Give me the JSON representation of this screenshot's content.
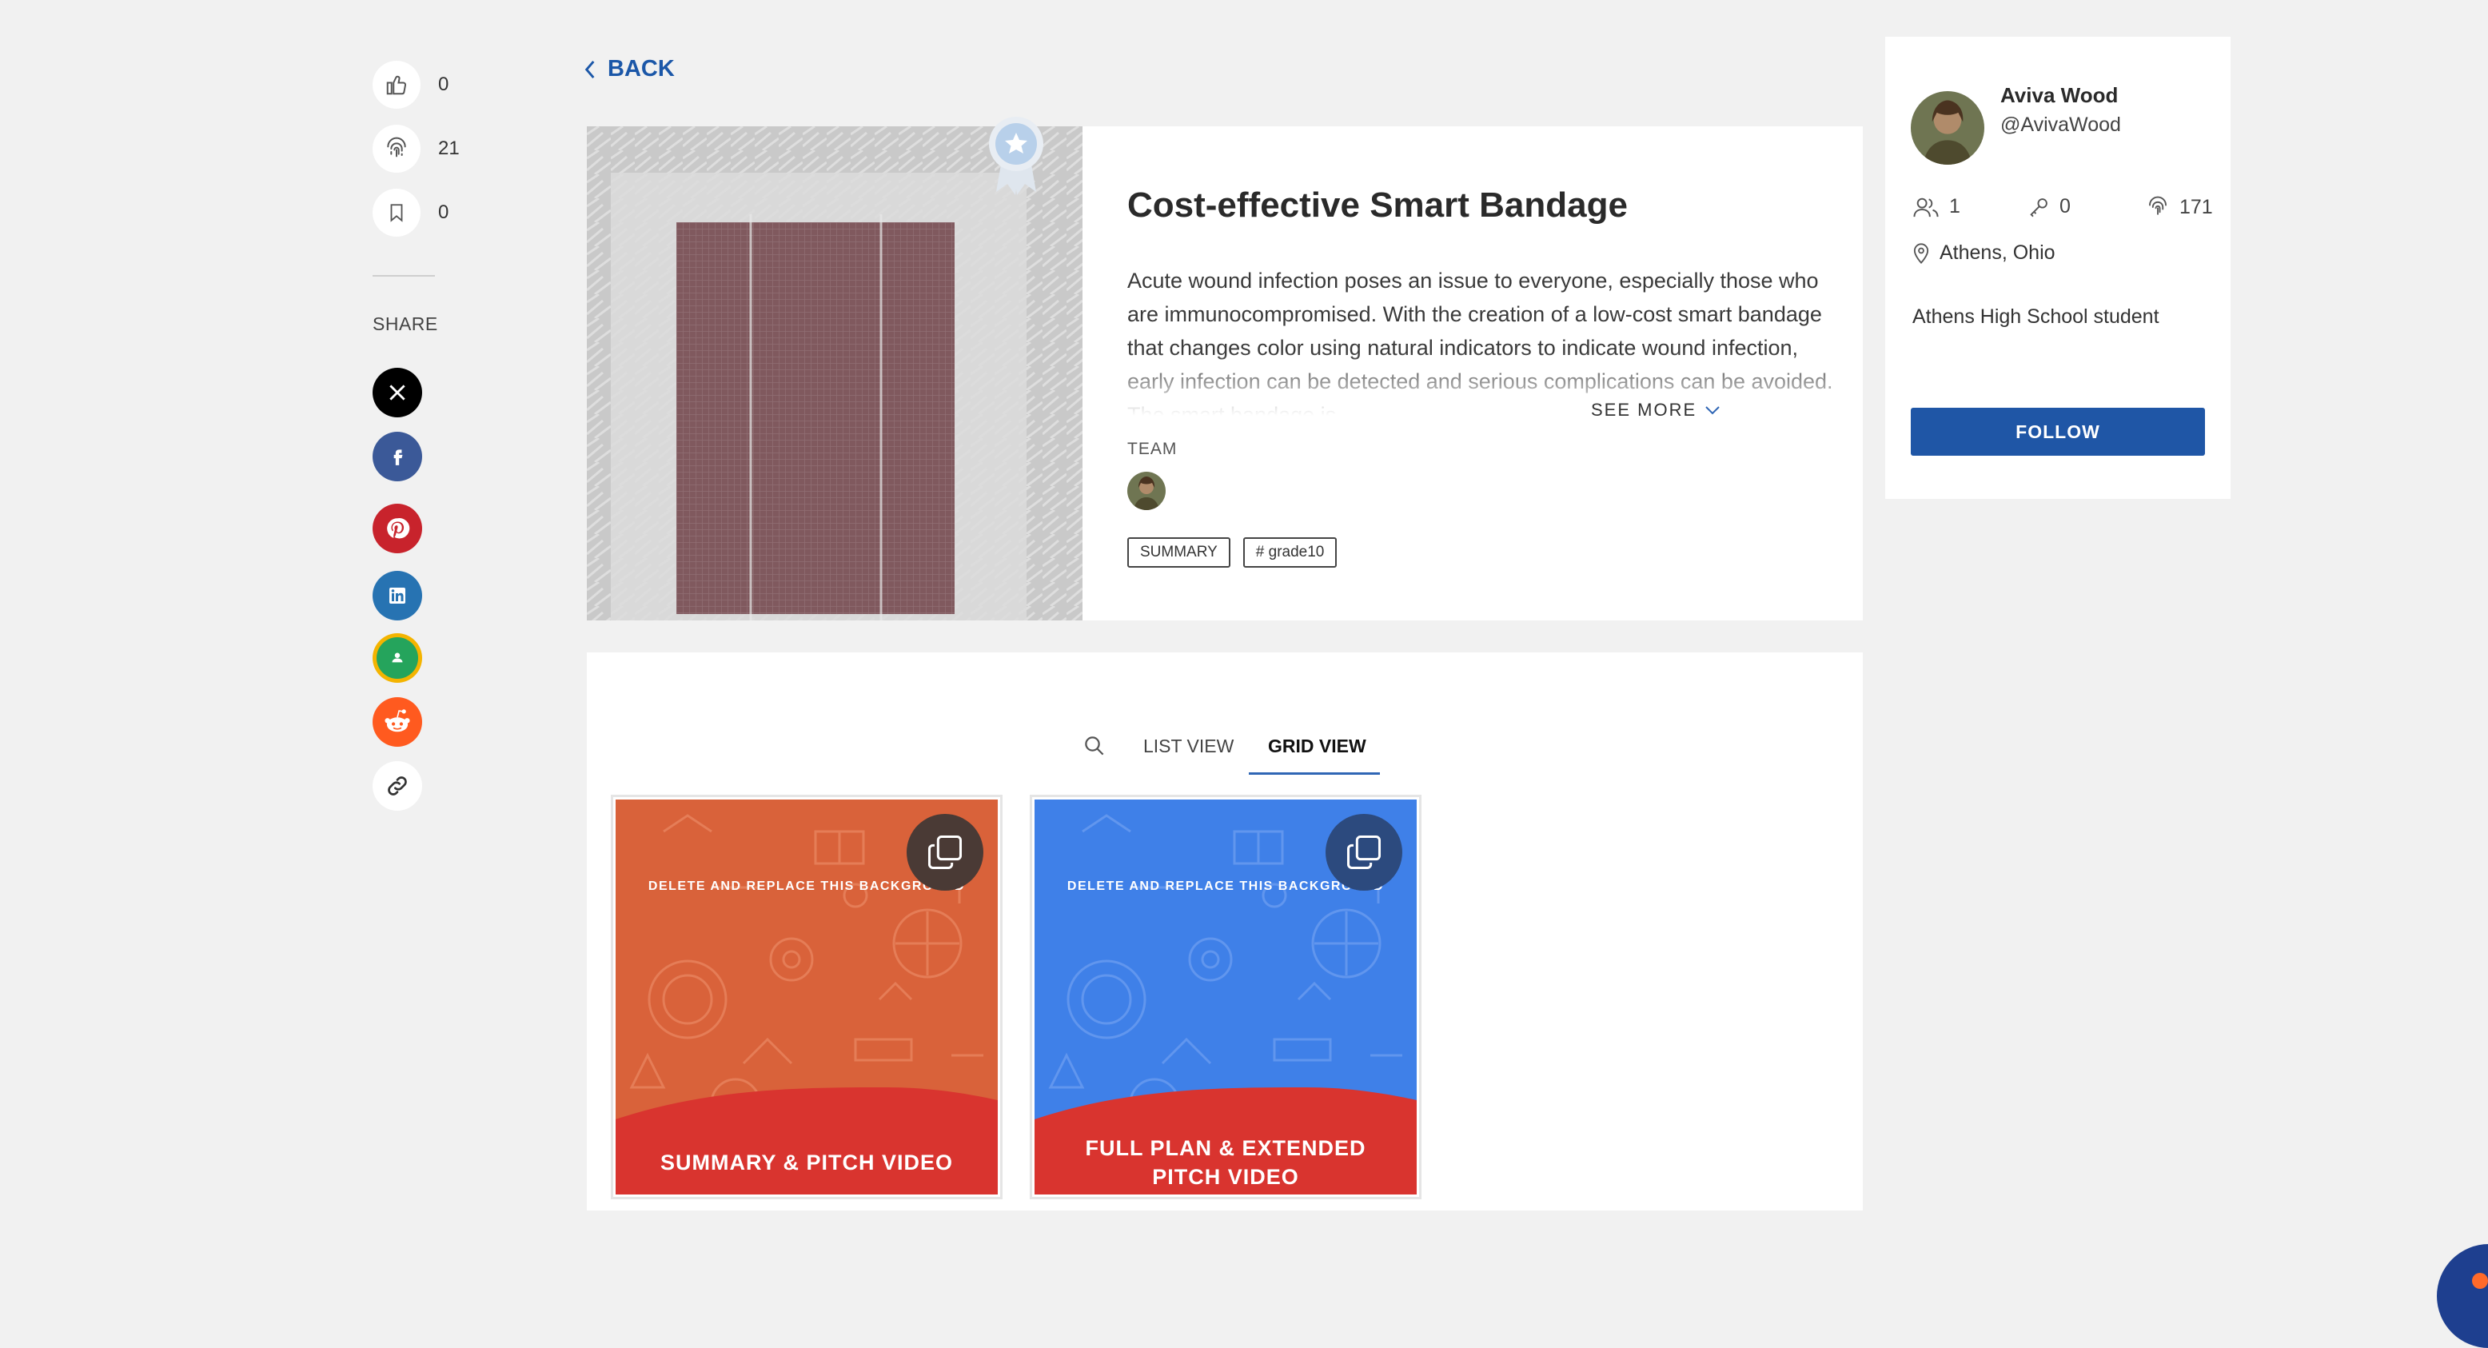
{
  "rail": {
    "likes": "0",
    "fingerprints": "21",
    "bookmarks": "0",
    "share_label": "SHARE",
    "social_icons": [
      "x-icon",
      "facebook-icon",
      "pinterest-icon",
      "linkedin-icon",
      "google-classroom-icon",
      "reddit-icon",
      "link-icon"
    ]
  },
  "nav": {
    "back_label": "BACK"
  },
  "project": {
    "title": "Cost-effective Smart Bandage",
    "description": "Acute wound infection poses an issue to everyone, especially those who are immunocompromised. With the creation of a low-cost smart bandage that changes color using natural indicators to indicate wound infection, early infection can be detected and serious complications can be avoided. The smart bandage is",
    "see_more": "SEE MORE",
    "team_label": "TEAM",
    "tags": [
      "SUMMARY",
      "# grade10"
    ]
  },
  "grid": {
    "tabs": {
      "list": "LIST VIEW",
      "grid": "GRID VIEW"
    },
    "active_tab": "grid",
    "tiles": [
      {
        "top_text": "DELETE AND REPLACE THIS BACKGROUND",
        "label": "SUMMARY & PITCH VIDEO",
        "bg": "#d9623a"
      },
      {
        "top_text": "DELETE AND REPLACE THIS BACKGROUND",
        "label": "FULL PLAN & EXTENDED PITCH VIDEO",
        "bg": "#3f80e8"
      }
    ]
  },
  "profile": {
    "name": "Aviva Wood",
    "handle": "@AvivaWood",
    "followers": "1",
    "keys": "0",
    "fingerprints": "171",
    "location": "Athens, Ohio",
    "bio": "Athens High School student",
    "follow_label": "FOLLOW"
  },
  "colors": {
    "accent": "#1f56a6",
    "tile_red": "#d9342f",
    "background": "#f1f1f1"
  }
}
